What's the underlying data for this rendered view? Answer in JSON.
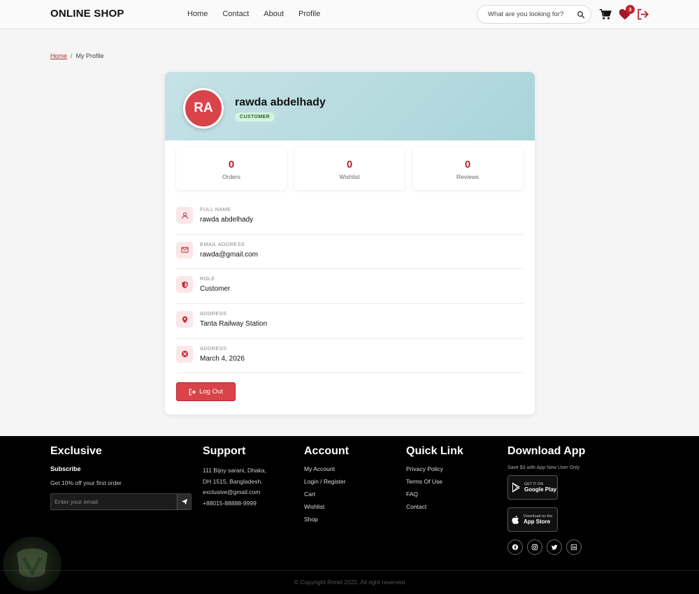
{
  "header": {
    "logo": "ONLINE SHOP",
    "nav": [
      "Home",
      "Contact",
      "About",
      "Profile"
    ],
    "search_placeholder": "What are you looking for?",
    "wishlist_count": "3"
  },
  "breadcrumb": {
    "home": "Home",
    "sep": "/",
    "current": "My Profile"
  },
  "profile": {
    "initials": "RA",
    "name": "rawda abdelhady",
    "role_badge": "CUSTOMER",
    "stats": [
      {
        "value": "0",
        "label": "Orders"
      },
      {
        "value": "0",
        "label": "Wishlist"
      },
      {
        "value": "0",
        "label": "Reviews"
      }
    ],
    "fields": [
      {
        "label": "FULL NAME",
        "value": "rawda abdelhady",
        "icon": "user-icon"
      },
      {
        "label": "EMAIL ADDRESS",
        "value": "rawda@gmail.com",
        "icon": "mail-icon"
      },
      {
        "label": "ROLE",
        "value": "Customer",
        "icon": "shield-icon"
      },
      {
        "label": "ADDRESS",
        "value": "Tanta Railway Station",
        "icon": "location-pin-icon"
      },
      {
        "label": "ADDRESS",
        "value": "March 4, 2026",
        "icon": "close-circle-icon"
      }
    ],
    "logout_label": "Log Out"
  },
  "footer": {
    "exclusive": {
      "title": "Exclusive",
      "subscribe": "Subscribe",
      "offer": "Get 10% off your first order",
      "email_placeholder": "Enter your email"
    },
    "support": {
      "title": "Support",
      "lines": [
        "111 Bijoy sarani, Dhaka,",
        "DH 1515, Bangladesh.",
        "exclusive@gmail.com",
        "+88015-88888-9999"
      ]
    },
    "account": {
      "title": "Account",
      "links": [
        "My Account",
        "Login / Register",
        "Cart",
        "Wishlist",
        "Shop"
      ]
    },
    "quick_link": {
      "title": "Quick Link",
      "links": [
        "Privacy Policy",
        "Terms Of Use",
        "FAQ",
        "Contact"
      ]
    },
    "download": {
      "title": "Download App",
      "save_text": "Save $3 with App New User Only",
      "google_small": "GET IT ON",
      "google_big": "Google Play",
      "apple_small": "Download on the",
      "apple_big": "App Store"
    },
    "copyright": "© Copyright Rimel 2022. All right reserved"
  },
  "colors": {
    "accent": "#d9434a",
    "accent_dark": "#b8232e",
    "badge_bg": "#d4f5dc",
    "header_gradient": "#b6dce0"
  }
}
